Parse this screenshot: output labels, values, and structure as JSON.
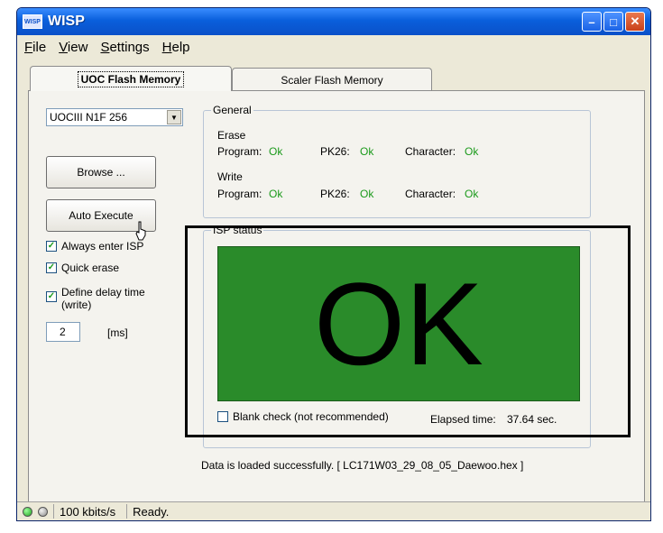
{
  "window": {
    "app_icon_label": "WISP",
    "title": "WISP"
  },
  "menu": [
    "File",
    "View",
    "Settings",
    "Help"
  ],
  "tabs": [
    {
      "label": "UOC Flash Memory",
      "active": true
    },
    {
      "label": "Scaler Flash Memory",
      "active": false
    }
  ],
  "left": {
    "chip_select": "UOCIII N1F 256",
    "browse_button": "Browse ...",
    "auto_execute_button": "Auto Execute",
    "always_enter_isp": {
      "label": "Always enter ISP",
      "checked": true
    },
    "quick_erase": {
      "label": "Quick erase",
      "checked": true
    },
    "define_delay": {
      "label_line1": "Define delay time",
      "label_line2": "(write)",
      "checked": true
    },
    "delay_value": "2",
    "delay_unit": "[ms]"
  },
  "general": {
    "title": "General",
    "erase_label": "Erase",
    "write_label": "Write",
    "erase": {
      "program_label": "Program:",
      "program_value": "Ok",
      "pk26_label": "PK26:",
      "pk26_value": "Ok",
      "character_label": "Character:",
      "character_value": "Ok"
    },
    "write": {
      "program_label": "Program:",
      "program_value": "Ok",
      "pk26_label": "PK26:",
      "pk26_value": "Ok",
      "character_label": "Character:",
      "character_value": "Ok"
    }
  },
  "isp_status": {
    "title": "ISP status",
    "status_text": "OK",
    "blank_check_label": "Blank check (not recommended)",
    "blank_check_checked": false,
    "elapsed_label": "Elapsed time:",
    "elapsed_value": "37.64 sec."
  },
  "message": "Data is loaded successfully. [ LC171W03_29_08_05_Daewoo.hex ]",
  "statusbar": {
    "speed": "100 kbits/s",
    "state": "Ready."
  },
  "colors": {
    "ok_panel": "#2a8b2a",
    "ok_text": "#1b9a1b",
    "titlebar": "#0a5fdc"
  }
}
